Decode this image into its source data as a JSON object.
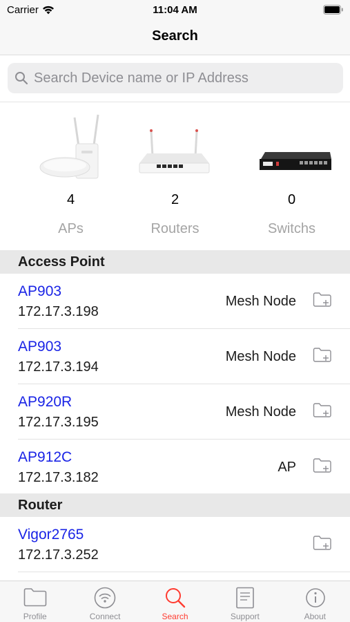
{
  "status_bar": {
    "carrier": "Carrier",
    "time": "11:04 AM"
  },
  "nav": {
    "title": "Search"
  },
  "search": {
    "placeholder": "Search Device name or IP Address"
  },
  "summary": [
    {
      "count": "4",
      "label": "APs",
      "icon": "access-point-icon"
    },
    {
      "count": "2",
      "label": "Routers",
      "icon": "router-icon"
    },
    {
      "count": "0",
      "label": "Switchs",
      "icon": "switch-icon"
    }
  ],
  "sections": {
    "access_point": {
      "title": "Access Point",
      "rows": [
        {
          "name": "AP903",
          "ip": "172.17.3.198",
          "role": "Mesh Node"
        },
        {
          "name": "AP903",
          "ip": "172.17.3.194",
          "role": "Mesh Node"
        },
        {
          "name": "AP920R",
          "ip": "172.17.3.195",
          "role": "Mesh Node"
        },
        {
          "name": "AP912C",
          "ip": "172.17.3.182",
          "role": "AP"
        }
      ]
    },
    "router": {
      "title": "Router",
      "rows": [
        {
          "name": "Vigor2765",
          "ip": "172.17.3.252",
          "role": ""
        }
      ]
    }
  },
  "tabs": [
    {
      "label": "Profile",
      "icon": "folder-icon"
    },
    {
      "label": "Connect",
      "icon": "wifi-circle-icon"
    },
    {
      "label": "Search",
      "icon": "search-icon"
    },
    {
      "label": "Support",
      "icon": "document-icon"
    },
    {
      "label": "About",
      "icon": "info-icon"
    }
  ],
  "colors": {
    "link_blue": "#1a24e6",
    "active_tab": "#ff3b30",
    "inactive_tab": "#8e8e93"
  }
}
